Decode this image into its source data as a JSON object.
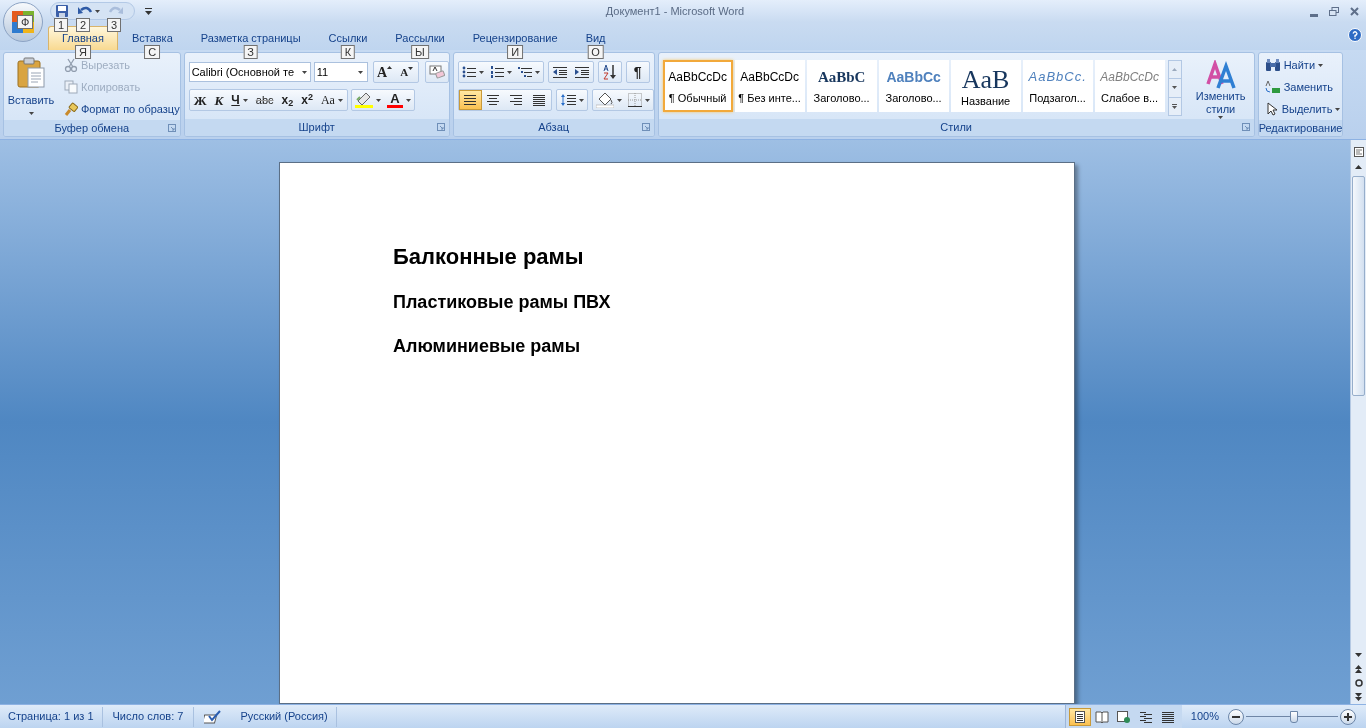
{
  "window": {
    "title": "Документ1 - Microsoft Word"
  },
  "office_button": {
    "key_tip": "Ф"
  },
  "quick_access": [
    {
      "kind": "save",
      "key_tip": "1",
      "disabled": false
    },
    {
      "kind": "undo",
      "key_tip": "2",
      "disabled": false
    },
    {
      "kind": "redo",
      "key_tip": "3",
      "disabled": true
    }
  ],
  "tabs": [
    {
      "label": "Главная",
      "key_tip": "Я",
      "selected": true
    },
    {
      "label": "Вставка",
      "key_tip": "С",
      "selected": false
    },
    {
      "label": "Разметка страницы",
      "key_tip": "З",
      "selected": false
    },
    {
      "label": "Ссылки",
      "key_tip": "К",
      "selected": false
    },
    {
      "label": "Рассылки",
      "key_tip": "Ы",
      "selected": false
    },
    {
      "label": "Рецензирование",
      "key_tip": "И",
      "selected": false
    },
    {
      "label": "Вид",
      "key_tip": "О",
      "selected": false
    }
  ],
  "clipboard": {
    "label": "Буфер обмена",
    "paste": "Вставить",
    "commands": [
      {
        "kind": "cut",
        "label": "Вырезать",
        "disabled": true
      },
      {
        "kind": "copy",
        "label": "Копировать",
        "disabled": true
      },
      {
        "kind": "format_painter",
        "label": "Формат по образцу",
        "disabled": false
      }
    ]
  },
  "font": {
    "label": "Шрифт",
    "font_name": "Calibri (Основной те",
    "font_size": "11",
    "grow": "A",
    "shrink": "A",
    "font_color": "A",
    "format_buttons": [
      {
        "kind": "bold",
        "text": "Ж"
      },
      {
        "kind": "italic",
        "text": "К"
      },
      {
        "kind": "underline",
        "text": "Ч"
      },
      {
        "kind": "strike",
        "text": "abc"
      },
      {
        "kind": "subscript",
        "text": "x$_{2}$"
      },
      {
        "kind": "superscript",
        "text": "x$^{2}$"
      },
      {
        "kind": "change_case",
        "text": "Aa"
      }
    ]
  },
  "paragraph": {
    "label": "Абзац",
    "show_marks": "¶",
    "alignment": [
      {
        "kind": "left",
        "selected": true
      },
      {
        "kind": "center",
        "selected": false
      },
      {
        "kind": "right",
        "selected": false
      },
      {
        "kind": "justify",
        "selected": false
      }
    ]
  },
  "styles": {
    "label": "Стили",
    "change_styles": "Изменить стили",
    "items": [
      {
        "kind": "normal",
        "preview": "AaBbCcDc",
        "name": "¶ Обычный",
        "selected": true
      },
      {
        "kind": "no_spacing",
        "preview": "AaBbCcDc",
        "name": "¶ Без инте...",
        "selected": false
      },
      {
        "kind": "heading1",
        "preview": "AaBbC",
        "name": "Заголово...",
        "selected": false
      },
      {
        "kind": "heading2",
        "preview": "AaBbCc",
        "name": "Заголово...",
        "selected": false
      },
      {
        "kind": "title",
        "preview": "AaB",
        "name": "Название",
        "selected": false
      },
      {
        "kind": "subtitle",
        "preview": "AaBbCc.",
        "name": "Подзагол...",
        "selected": false
      },
      {
        "kind": "subtle",
        "preview": "AaBbCcDc",
        "name": "Слабое в...",
        "selected": false
      }
    ]
  },
  "editing": {
    "label": "Редактирование",
    "commands": [
      {
        "kind": "find",
        "label": "Найти"
      },
      {
        "kind": "replace",
        "label": "Заменить"
      },
      {
        "kind": "select",
        "label": "Выделить"
      }
    ]
  },
  "document": {
    "paragraphs": [
      {
        "kind": "heading1",
        "text": "Балконные рамы"
      },
      {
        "kind": "heading2",
        "text": "Пластиковые рамы ПВХ"
      },
      {
        "kind": "heading2",
        "text": "Алюминиевые рамы"
      }
    ]
  },
  "status_bar": {
    "page": "Страница: 1 из 1",
    "words": "Число слов: 7",
    "language": "Русский (Россия)",
    "zoom": "100%",
    "zoom_slider": {
      "level": 0.52
    },
    "views": [
      {
        "kind": "print_layout",
        "selected": true
      },
      {
        "kind": "reading",
        "selected": false
      },
      {
        "kind": "web",
        "selected": false
      },
      {
        "kind": "outline",
        "selected": false
      },
      {
        "kind": "draft",
        "selected": false
      }
    ]
  }
}
